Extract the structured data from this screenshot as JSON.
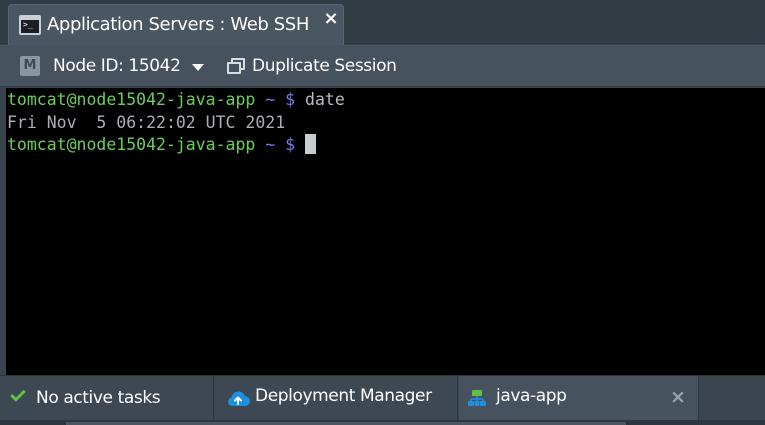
{
  "tab": {
    "title": "Application Servers : Web SSH",
    "icon": "terminal-icon",
    "close_icon": "close-icon"
  },
  "toolbar": {
    "node_icon": "node-m-icon",
    "node_icon_letter": "M",
    "node_selector_label": "Node ID: 15042",
    "duplicate_icon": "duplicate-windows-icon",
    "duplicate_label": "Duplicate Session"
  },
  "terminal": {
    "lines": [
      {
        "type": "command",
        "user_host": "tomcat@node15042-java-app",
        "path": "~",
        "prompt": "$",
        "command": "date"
      },
      {
        "type": "output",
        "text": "Fri Nov  5 06:22:02 UTC 2021"
      },
      {
        "type": "prompt",
        "user_host": "tomcat@node15042-java-app",
        "path": "~",
        "prompt": "$",
        "command": ""
      }
    ],
    "colors": {
      "background": "#000000",
      "user_host": "#6ccd5a",
      "path": "#6e7cf0",
      "output": "#a9afb5"
    }
  },
  "statusbar": {
    "tasks_icon": "checkmark-icon",
    "tasks_label": "No active tasks",
    "deployment_icon": "cloud-upload-icon",
    "deployment_label": "Deployment Manager",
    "env_icon": "environment-topology-icon",
    "env_label": "java-app",
    "env_close_icon": "close-icon"
  },
  "colors": {
    "accent_green": "#5dc14a",
    "accent_blue": "#1e90e0",
    "panel": "#46525d",
    "background": "#39444e"
  }
}
